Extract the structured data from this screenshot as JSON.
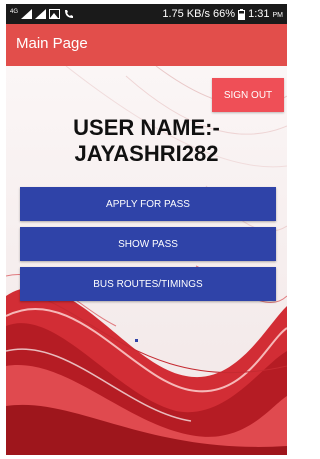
{
  "status_bar": {
    "network": "4G",
    "signal_icon": "signal-icon",
    "photo_icon": "image-icon",
    "phone_icon": "phone-icon",
    "data_speed": "1.75 KB/s",
    "battery": "66%",
    "battery_icon": "battery-icon",
    "time": "1:31",
    "ampm": "PM"
  },
  "app_bar": {
    "title": "Main Page",
    "color": "#e24e4b"
  },
  "main": {
    "sign_out_label": "SIGN OUT",
    "username_label": "USER NAME:-",
    "username_value": "JAYASHRI282",
    "buttons": [
      {
        "label": "APPLY FOR PASS"
      },
      {
        "label": "SHOW PASS"
      },
      {
        "label": "BUS ROUTES/TIMINGS"
      }
    ],
    "button_color": "#2f43a8",
    "accent_red": "#ef4f57"
  }
}
